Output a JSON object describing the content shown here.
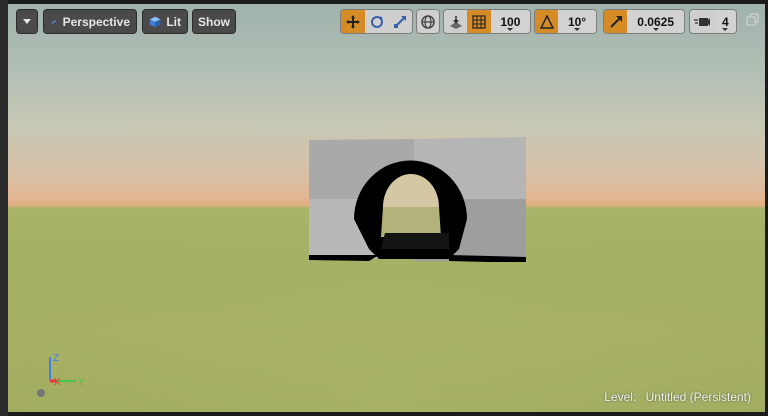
{
  "toolbar": {
    "view_mode": "Perspective",
    "lighting_mode": "Lit",
    "show_label": "Show",
    "grid_snap_value": "100",
    "rotation_snap_value": "10°",
    "scale_snap_value": "0.0625",
    "camera_speed_value": "4"
  },
  "status": {
    "level_label": "Level:",
    "level_name": "Untitled (Persistent)"
  },
  "axis": {
    "z": "Z",
    "x": "X",
    "y": "Y"
  },
  "colors": {
    "accent": "#d58b26",
    "axis_x": "#e53935",
    "axis_y": "#43c943",
    "axis_z": "#3f7fe8"
  }
}
